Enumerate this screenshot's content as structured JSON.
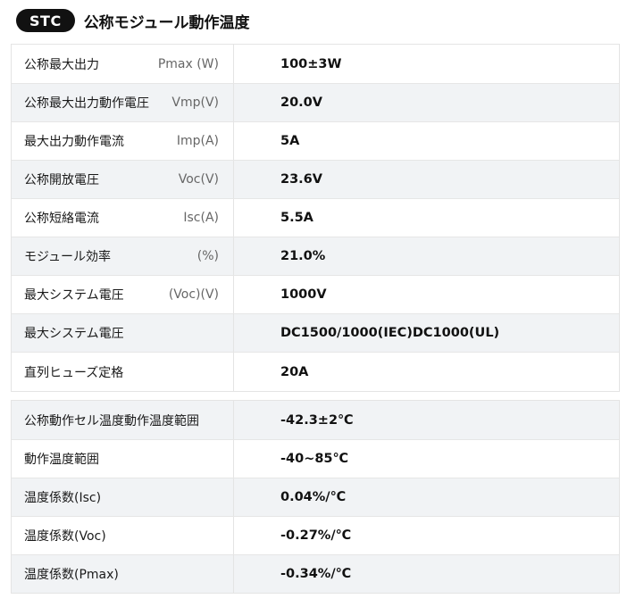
{
  "header": {
    "badge": "STC",
    "title": "公称モジュール動作温度"
  },
  "table1": [
    {
      "label": "公称最大出力",
      "unit": "Pmax (W)",
      "value": "100±3W"
    },
    {
      "label": "公称最大出力動作電圧",
      "unit": "Vmp(V)",
      "value": "20.0V"
    },
    {
      "label": "最大出力動作電流",
      "unit": "Imp(A)",
      "value": "5A"
    },
    {
      "label": "公称開放電圧",
      "unit": "Voc(V)",
      "value": "23.6V"
    },
    {
      "label": "公称短絡電流",
      "unit": "Isc(A)",
      "value": "5.5A"
    },
    {
      "label": "モジュール効率",
      "unit": "(%)",
      "value": "21.0%"
    },
    {
      "label": "最大システム電圧",
      "unit": "(Voc)(V)",
      "value": "1000V"
    },
    {
      "label": "最大システム電圧",
      "unit": "",
      "value": "DC1500/1000(IEC)DC1000(UL)"
    },
    {
      "label": "直列ヒューズ定格",
      "unit": "",
      "value": "20A"
    }
  ],
  "table2": [
    {
      "label": "公称動作セル温度動作温度範囲",
      "value": "-42.3±2℃"
    },
    {
      "label": "動作温度範囲",
      "value": "-40~85℃"
    },
    {
      "label": "温度係数(Isc)",
      "value": "0.04%/℃"
    },
    {
      "label": "温度係数(Voc)",
      "value": "-0.27%/℃"
    },
    {
      "label": "温度係数(Pmax)",
      "value": "-0.34%/℃"
    }
  ]
}
